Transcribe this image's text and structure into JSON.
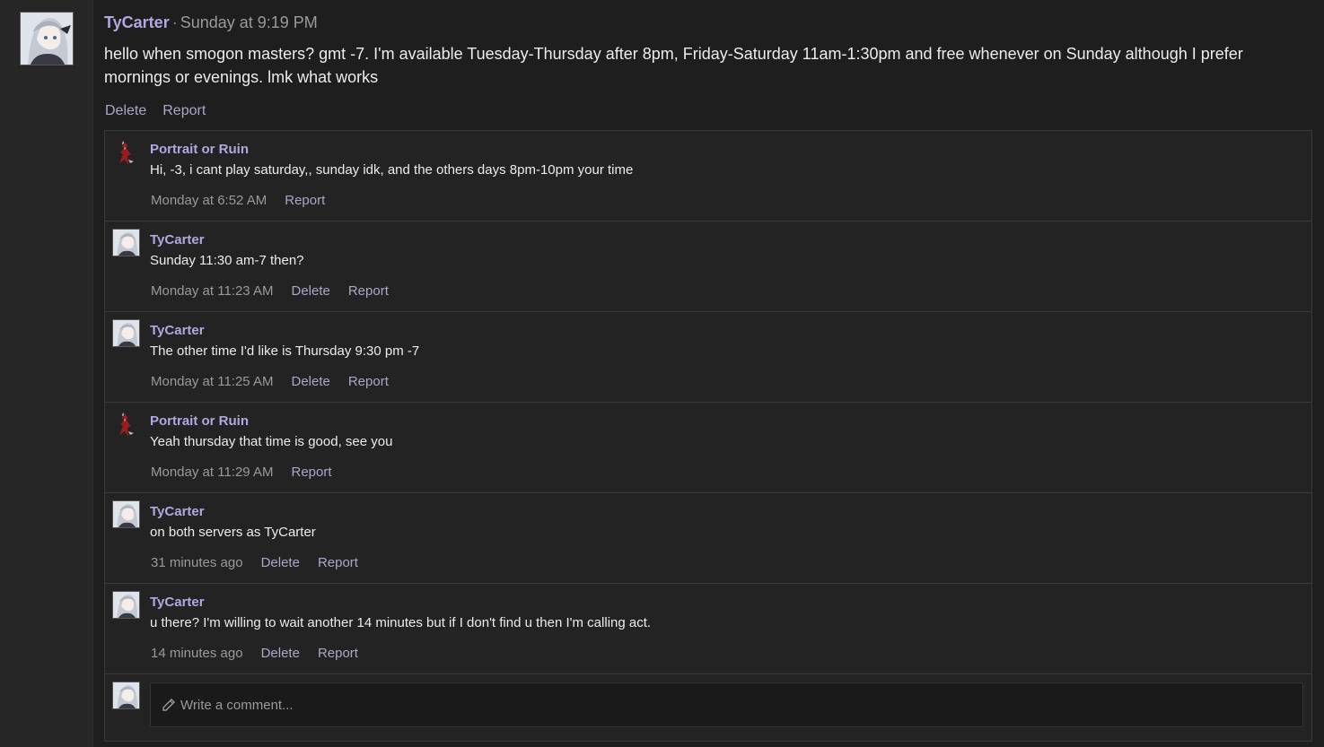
{
  "post": {
    "author": "TyCarter",
    "separator": "·",
    "time": "Sunday at 9:19 PM",
    "body": "hello when smogon masters? gmt -7. I'm available Tuesday-Thursday after 8pm, Friday-Saturday 11am-1:30pm and free whenever on Sunday although I prefer mornings or evenings. lmk what works",
    "delete_label": "Delete",
    "report_label": "Report"
  },
  "comments": [
    {
      "author": "Portrait or Ruin",
      "avatar": "portrait-or-ruin-avatar",
      "text": "Hi, -3, i cant play saturday,, sunday idk, and the others days 8pm-10pm your time",
      "time": "Monday at 6:52 AM",
      "delete": "",
      "report": "Report"
    },
    {
      "author": "TyCarter",
      "avatar": "tycarter-avatar",
      "text": "Sunday 11:30 am-7 then?",
      "time": "Monday at 11:23 AM",
      "delete": "Delete",
      "report": "Report"
    },
    {
      "author": "TyCarter",
      "avatar": "tycarter-avatar",
      "text": "The other time I'd like is Thursday 9:30 pm -7",
      "time": "Monday at 11:25 AM",
      "delete": "Delete",
      "report": "Report"
    },
    {
      "author": "Portrait or Ruin",
      "avatar": "portrait-or-ruin-avatar",
      "text": "Yeah thursday that time is good, see you",
      "time": "Monday at 11:29 AM",
      "delete": "",
      "report": "Report"
    },
    {
      "author": "TyCarter",
      "avatar": "tycarter-avatar",
      "text": "on both servers as TyCarter",
      "time": "31 minutes ago",
      "delete": "Delete",
      "report": "Report"
    },
    {
      "author": "TyCarter",
      "avatar": "tycarter-avatar",
      "text": "u there? I'm willing to wait another 14 minutes but if I don't find u then I'm calling act.",
      "time": "14 minutes ago",
      "delete": "Delete",
      "report": "Report"
    }
  ],
  "composer": {
    "placeholder": "Write a comment...",
    "icon": "pencil-icon"
  },
  "colors": {
    "author": "#b4a6e0",
    "action": "#a8a8c8",
    "muted": "#9a9a9a",
    "background": "#1e1e1e"
  }
}
